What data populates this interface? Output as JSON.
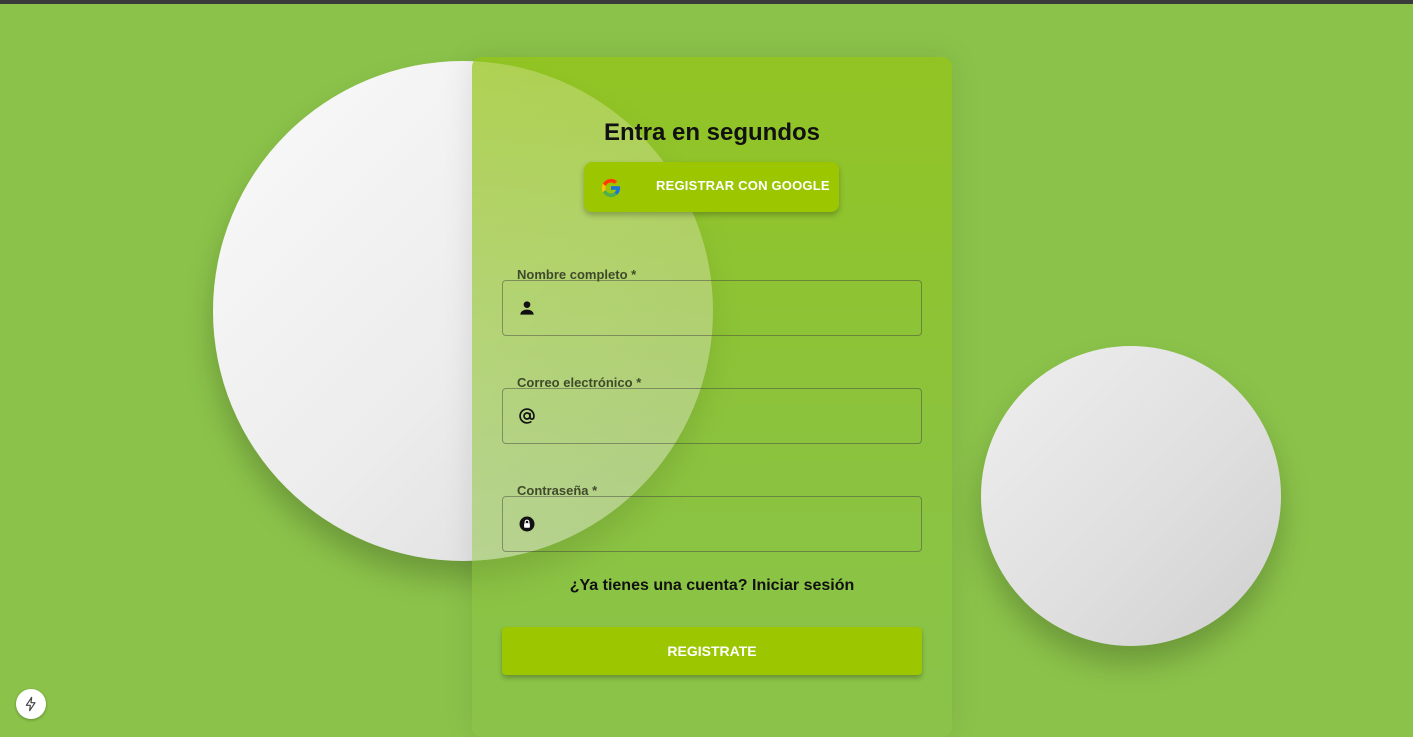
{
  "form": {
    "title": "Entra en segundos",
    "google_button_label": "REGISTRAR CON GOOGLE",
    "fields": [
      {
        "label": "Nombre completo *",
        "icon": "person-icon",
        "value": ""
      },
      {
        "label": "Correo electrónico *",
        "icon": "at-sign-icon",
        "value": ""
      },
      {
        "label": "Contraseña *",
        "icon": "lock-icon",
        "value": ""
      }
    ],
    "login_link": "¿Ya tienes una cuenta? Iniciar sesión",
    "submit_label": "REGISTRATE"
  },
  "colors": {
    "background": "#8bc34a",
    "accent": "#9cc700",
    "card_tint": "#94c414"
  },
  "icons": {
    "google": "google-icon",
    "bolt": "bolt-icon"
  }
}
